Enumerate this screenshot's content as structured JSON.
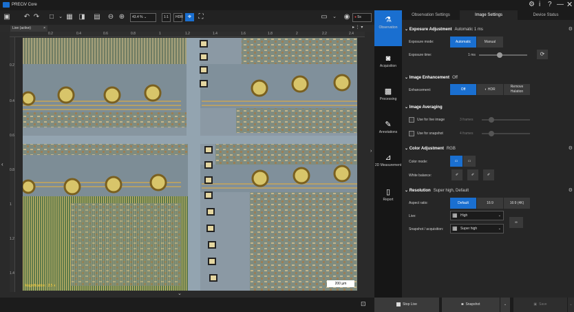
{
  "app": {
    "title": "PRECiV Core"
  },
  "titlebar": {
    "icons": [
      "settings-icon",
      "info-icon",
      "help-icon",
      "minimize-icon",
      "close-icon"
    ]
  },
  "toolbar": {
    "zoom_value": "43.4 %",
    "fit_label": "1:1",
    "hdr_label": "HDR",
    "ss_label": "5s"
  },
  "image_tab": {
    "label": "Live (active)"
  },
  "ruler": {
    "top": [
      "0.2",
      "0.4",
      "0.6",
      "0.8",
      "1",
      "1.2",
      "1.4",
      "1.6",
      "1.8",
      "2",
      "2.2",
      "2.4"
    ],
    "left": [
      "0.2",
      "0.4",
      "0.6",
      "0.8",
      "1",
      "1.2",
      "1.4"
    ]
  },
  "image_overlay": {
    "magnification": "Magnification : 2.5 x",
    "scale_bar": "200 µm"
  },
  "vnav": [
    {
      "label": "Observation",
      "icon": "microscope-icon"
    },
    {
      "label": "Acquisition",
      "icon": "camera-icon"
    },
    {
      "label": "Processing",
      "icon": "grid-icon"
    },
    {
      "label": "Annotations",
      "icon": "pencil-icon"
    },
    {
      "label": "2D Measurement",
      "icon": "ruler-icon"
    },
    {
      "label": "Report",
      "icon": "document-icon"
    }
  ],
  "panel_tabs": [
    {
      "label": "Observation Settings"
    },
    {
      "label": "Image Settings"
    },
    {
      "label": "Device Status"
    }
  ],
  "exposure": {
    "title": "Exposure Adjustment",
    "summary": "Automatic 1 ms",
    "mode_label": "Exposure mode:",
    "mode_automatic": "Automatic",
    "mode_manual": "Manual",
    "time_label": "Exposure time:",
    "time_value": "1 ms"
  },
  "enhancement": {
    "title": "Image Enhancement",
    "summary": "Off",
    "label": "Enhancement:",
    "off": "Off",
    "hdr": "HDR",
    "remove_halation": "Remove Halation"
  },
  "averaging": {
    "title": "Image Averaging",
    "live_label": "Use for live image",
    "live_frames": "3 frames",
    "snap_label": "Use for snapshot",
    "snap_frames": "4 frames"
  },
  "color": {
    "title": "Color Adjustment",
    "summary": "RGB",
    "mode_label": "Color mode:",
    "wb_label": "White balance:"
  },
  "resolution": {
    "title": "Resolution",
    "summary": "Super high, Default",
    "aspect_label": "Aspect ratio:",
    "aspect_default": "Default",
    "aspect_16_9": "16:9",
    "aspect_16_9_4k": "16:9 (4K)",
    "live_label": "Live:",
    "live_value": "High",
    "snap_label": "Snapshot / acquisition:",
    "snap_value": "Super high"
  },
  "statusbar": {
    "stop_live": "Stop Live",
    "snapshot": "Snapshot",
    "save": "Save"
  },
  "colors": {
    "accent": "#1a6fd0",
    "bg": "#1e1e1e",
    "panel": "#262626"
  }
}
